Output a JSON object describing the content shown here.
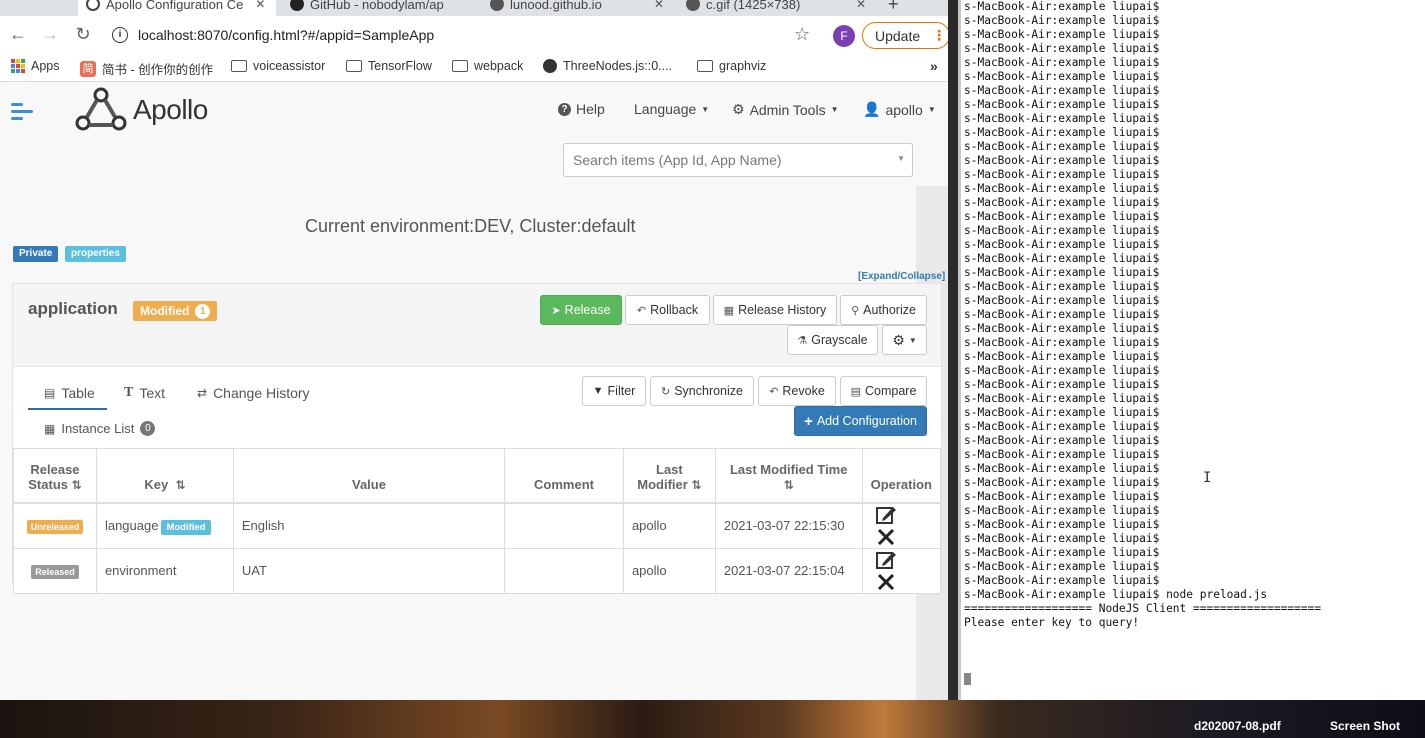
{
  "browser": {
    "tabs": [
      {
        "title": "Apollo Configuration Ce"
      },
      {
        "title": "GitHub - nobodylam/ap"
      },
      {
        "title": "lunood.github.io"
      },
      {
        "title": "c.gif (1425×738)"
      }
    ],
    "new_tab": "+",
    "url": "localhost:8070/config.html?#/appid=SampleApp",
    "update_label": "Update",
    "profile_initial": "F",
    "bookmarks": [
      {
        "label": "Apps",
        "icon": "apps-grid-icon"
      },
      {
        "label": "简书 - 创作你的创作",
        "icon": "jianshu-icon"
      },
      {
        "label": "voiceassistor",
        "icon": "folder-icon"
      },
      {
        "label": "TensorFlow",
        "icon": "folder-icon"
      },
      {
        "label": "webpack",
        "icon": "folder-icon"
      },
      {
        "label": "ThreeNodes.js::0....",
        "icon": "globe-icon"
      },
      {
        "label": "graphviz",
        "icon": "folder-icon"
      }
    ],
    "bookmarks_more": "»"
  },
  "apollo": {
    "logo": "Apollo",
    "nav": {
      "help": "Help",
      "language": "Language",
      "admin_tools": "Admin Tools",
      "user": "apollo"
    },
    "search_placeholder": "Search items (App Id, App Name)",
    "env_title": "Current environment:DEV,    Cluster:default",
    "labels": {
      "private": "Private",
      "properties": "properties"
    },
    "expand_collapse": "[Expand/Collapse]",
    "namespace": {
      "name": "application",
      "badge": "Modified",
      "badge_count": "1",
      "buttons": {
        "release": "Release",
        "rollback": "Rollback",
        "release_history": "Release History",
        "authorize": "Authorize",
        "grayscale": "Grayscale"
      }
    },
    "view_tabs": {
      "table": "Table",
      "text": "Text",
      "change_history": "Change History",
      "instance_list": "Instance List",
      "instance_count": "0"
    },
    "actions": {
      "filter": "Filter",
      "synchronize": "Synchronize",
      "revoke": "Revoke",
      "compare": "Compare",
      "add": "Add Configuration"
    },
    "table": {
      "headers": [
        "Release Status",
        "Key",
        "Value",
        "Comment",
        "Last Modifier",
        "Last Modified Time",
        "Operation"
      ],
      "rows": [
        {
          "status": "Unreleased",
          "status_color": "#f0ad4e",
          "key": "language",
          "key_tag": "Modified",
          "value": "English",
          "comment": "",
          "modifier": "apollo",
          "time": "2021-03-07 22:15:30"
        },
        {
          "status": "Released",
          "status_color": "#999999",
          "key": "environment",
          "key_tag": "",
          "value": "UAT",
          "comment": "",
          "modifier": "apollo",
          "time": "2021-03-07 22:15:04"
        }
      ]
    }
  },
  "terminal": {
    "prompt_line": "s-MacBook-Air:example liupai$",
    "prompt_repeat": 42,
    "command_line": "s-MacBook-Air:example liupai$ node preload.js",
    "output": [
      "=================== NodeJS Client ===================",
      "Please enter key to query!"
    ]
  },
  "desktop": {
    "file1": "d202007-08.pdf",
    "file2": "Screen Shot"
  },
  "colors": {
    "accent": "#337ab7",
    "release_green": "#5cb85c",
    "modified_orange": "#f0ad4e",
    "info_cyan": "#5bc0de"
  }
}
